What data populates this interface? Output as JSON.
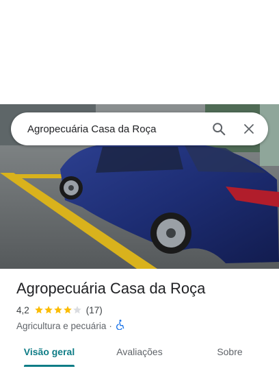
{
  "search": {
    "query": "Agropecuária Casa da Roça"
  },
  "place": {
    "name": "Agropecuária Casa da Roça",
    "rating": "4,2",
    "stars": 4.2,
    "review_count": "(17)",
    "category": "Agricultura e pecuária",
    "separator": "·"
  },
  "tabs": [
    {
      "label": "Visão geral",
      "active": true
    },
    {
      "label": "Avaliações",
      "active": false
    },
    {
      "label": "Sobre",
      "active": false
    }
  ],
  "colors": {
    "accent": "#0e7c86",
    "star": "#fbbc04",
    "star_empty": "#dadce0",
    "accessibility": "#1a73e8"
  }
}
